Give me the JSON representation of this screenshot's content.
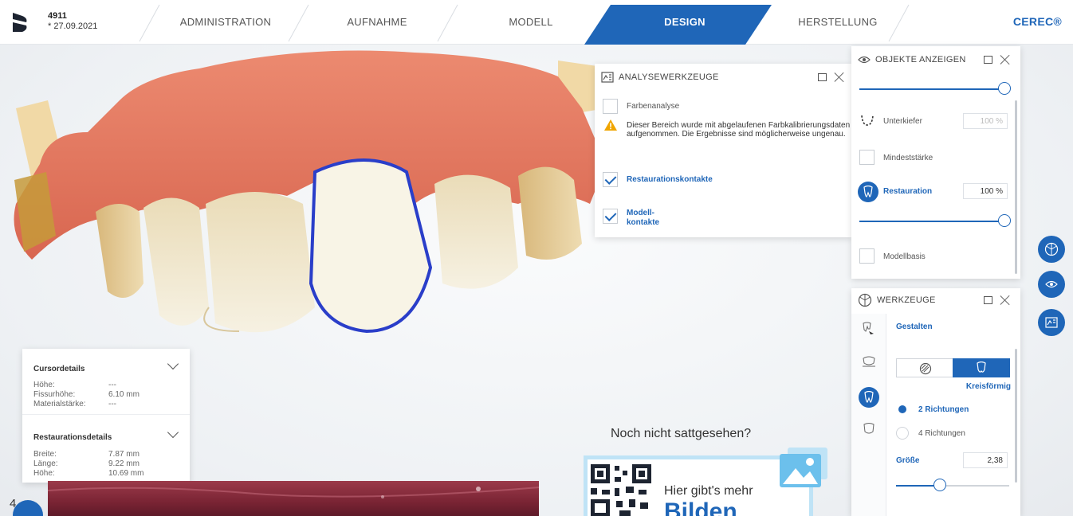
{
  "case": {
    "id": "4911",
    "date": "* 27.09.2021"
  },
  "workflow": {
    "steps": [
      "ADMINISTRATION",
      "AUFNAHME",
      "MODELL",
      "DESIGN",
      "HERSTELLUNG"
    ],
    "active_step": "DESIGN"
  },
  "brand": "CEREC®",
  "analysis_panel": {
    "title": "ANALYSEWERKZEUGE",
    "color_analysis": {
      "label": "Farbenanalyse",
      "checked": false
    },
    "warning": "Dieser Bereich wurde mit abgelaufenen Farbkalibrierungsdaten aufgenommen. Die Ergebnisse sind möglicherweise ungenau.",
    "restoration_contacts": {
      "label": "Restaurationskontakte",
      "checked": true
    },
    "model_contacts": {
      "label_line1": "Modell-",
      "label_line2": "kontakte",
      "checked": true
    }
  },
  "objects_panel": {
    "title": "OBJEKTE ANZEIGEN",
    "top_slider": 1.0,
    "lower_jaw": {
      "label": "Unterkiefer",
      "value": "100 %"
    },
    "min_thickness": {
      "label": "Mindeststärke",
      "checked": false
    },
    "restoration": {
      "label": "Restauration",
      "value": "100 %",
      "slider": 1.0
    },
    "model_base": {
      "label": "Modellbasis",
      "checked": false
    }
  },
  "tools_panel": {
    "title": "WERKZEUGE",
    "mode": "Gestalten",
    "shape_label": "Kreisförmig",
    "direction_options": [
      "2 Richtungen",
      "4 Richtungen"
    ],
    "selected_direction": "2 Richtungen",
    "size_label": "Größe",
    "size_value": "2,38",
    "size_slider": 0.42
  },
  "cursor_details": {
    "title": "Cursordetails",
    "rows": [
      {
        "key": "Höhe:",
        "value": "---"
      },
      {
        "key": "Fissurhöhe:",
        "value": "6.10 mm"
      },
      {
        "key": "Materialstärke:",
        "value": "---"
      }
    ]
  },
  "restoration_details": {
    "title": "Restaurationsdetails",
    "rows": [
      {
        "key": "Breite:",
        "value": "7.87 mm"
      },
      {
        "key": "Länge:",
        "value": "9.22 mm"
      },
      {
        "key": "Höhe:",
        "value": "10.69 mm"
      }
    ]
  },
  "promo": {
    "question": "Noch nicht sattgesehen?",
    "more": "Hier gibt's mehr",
    "big": "Bilden"
  },
  "page_number": "4",
  "colors": {
    "accent": "#1f66b8",
    "gingiva": "#e0745c",
    "tooth": "#f2ecd6",
    "crown": "#f7f3e6",
    "contact": "#2a3ec9"
  }
}
